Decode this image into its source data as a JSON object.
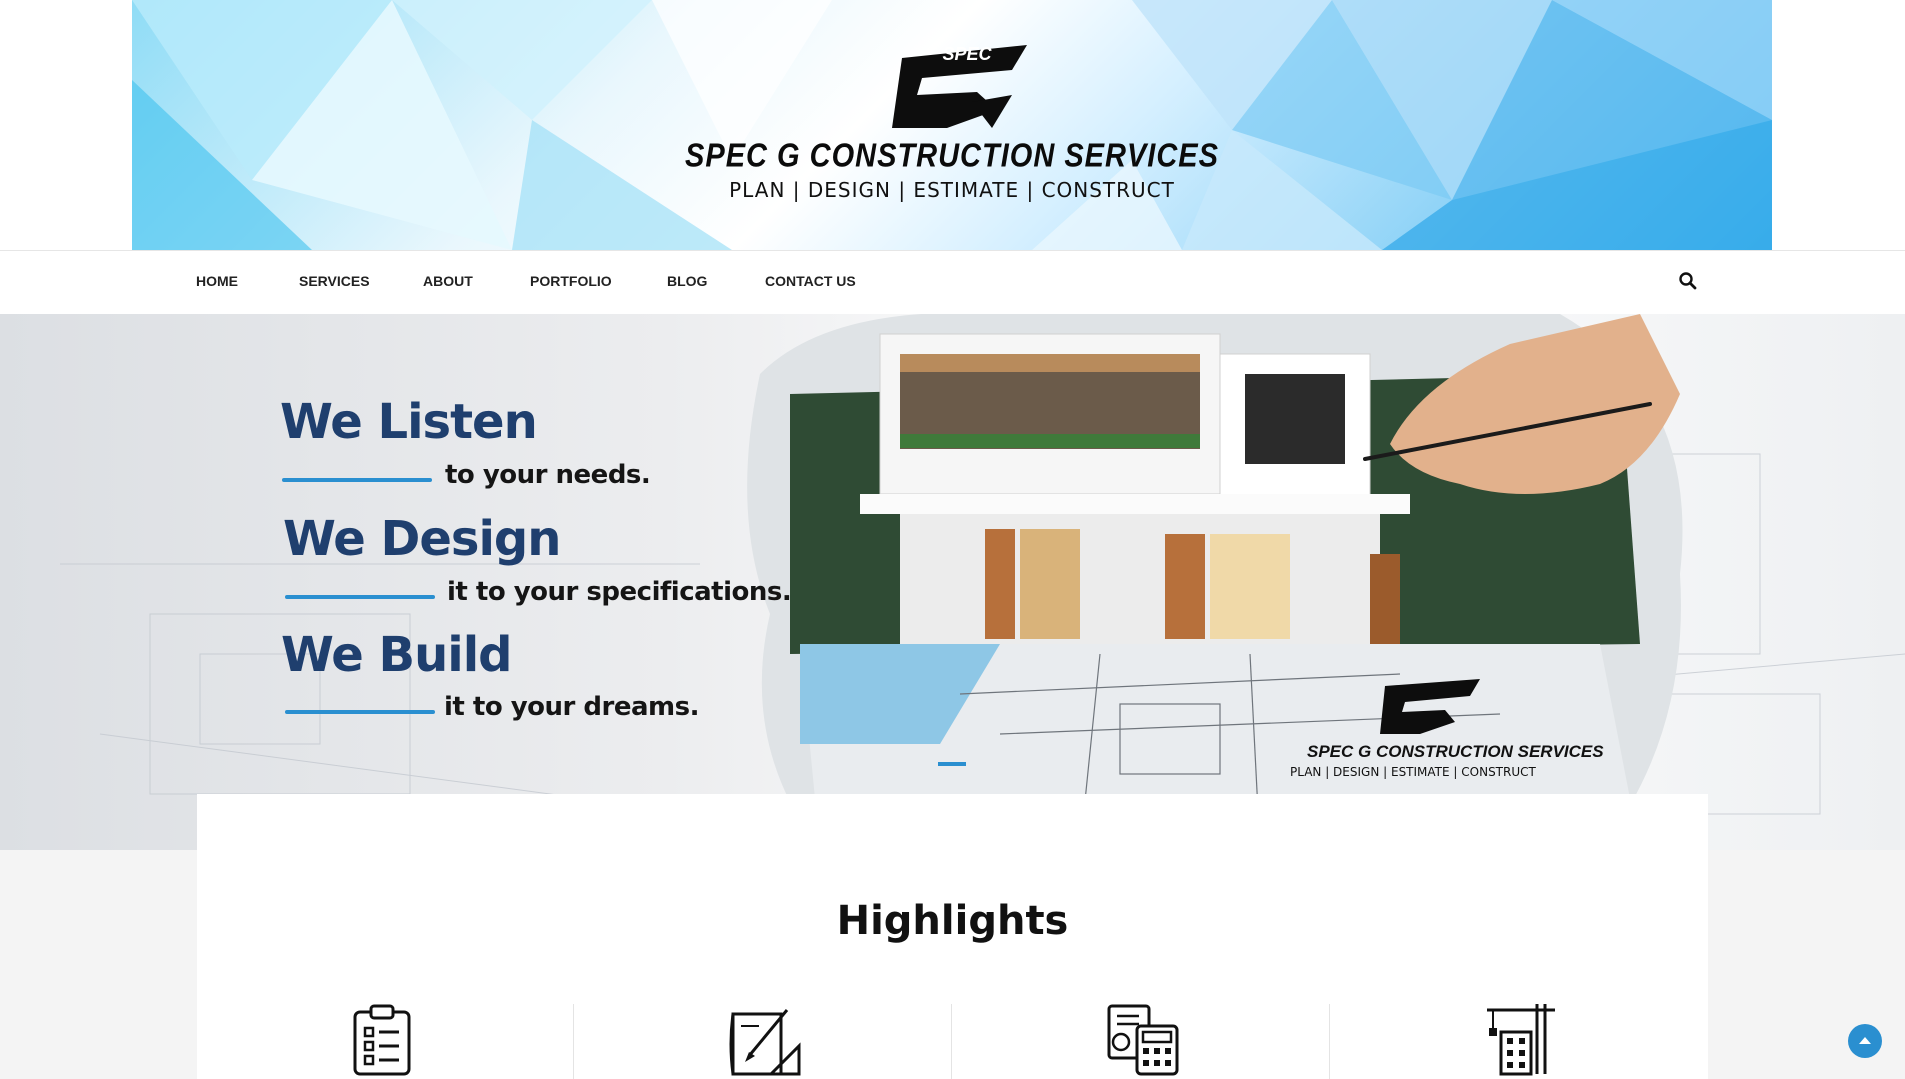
{
  "header": {
    "logo_text": "SPEC",
    "brand_title": "SPEC G CONSTRUCTION SERVICES",
    "tagline": "PLAN | DESIGN | ESTIMATE | CONSTRUCT"
  },
  "nav": {
    "items": [
      {
        "label": "HOME"
      },
      {
        "label": "SERVICES"
      },
      {
        "label": "ABOUT"
      },
      {
        "label": "PORTFOLIO"
      },
      {
        "label": "BLOG"
      },
      {
        "label": "CONTACT US"
      }
    ],
    "search_icon": "search-icon"
  },
  "hero": {
    "lines": [
      {
        "head": "We Listen",
        "sub": "to your needs."
      },
      {
        "head": "We Design",
        "sub": "it to your specifications."
      },
      {
        "head": "We Build",
        "sub": "it to your dreams."
      }
    ],
    "brand_title": "SPEC G CONSTRUCTION SERVICES",
    "brand_tagline": "PLAN | DESIGN | ESTIMATE | CONSTRUCT",
    "accent_color": "#2a8fd0"
  },
  "highlights": {
    "title": "Highlights",
    "icons": [
      "clipboard-checklist-icon",
      "blueprint-drawing-icon",
      "calculator-estimate-icon",
      "crane-building-icon"
    ]
  },
  "colors": {
    "accent": "#2a8fd0",
    "navy": "#1f3f6e"
  }
}
